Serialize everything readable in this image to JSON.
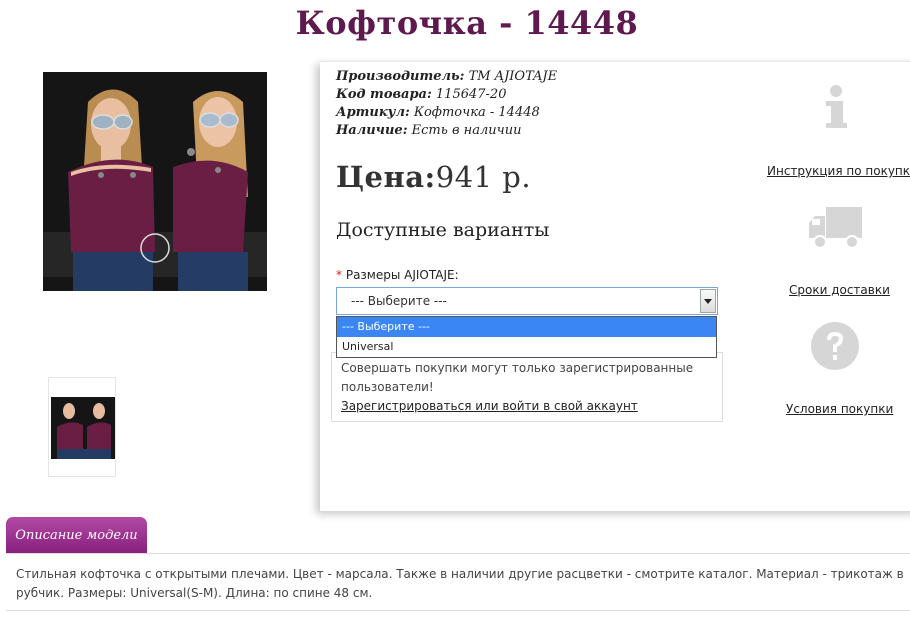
{
  "product": {
    "title": "Кофточка - 14448",
    "image_tag": "14448",
    "brand_logo": "Ajiotaje"
  },
  "info": {
    "manufacturer_label": "Производитель:",
    "manufacturer_value": "ТМ AJIOTAJE",
    "code_label": "Код товара:",
    "code_value": "115647-20",
    "article_label": "Артикул:",
    "article_value": "Кофточка - 14448",
    "availability_label": "Наличие:",
    "availability_value": "Есть в наличии"
  },
  "price": {
    "label": "Цена:",
    "value": "941 р."
  },
  "variants": {
    "heading": "Доступные варианты",
    "required_mark": "*",
    "size_label": "Размеры AJIOTAJE:",
    "select_value": "--- Выберите ---",
    "options": [
      "--- Выберите ---",
      "Universal"
    ]
  },
  "notice": {
    "text": "Совершать покупки могут только зарегистрированные пользователи!",
    "link": "Зарегистрироваться или войти в свой аккаунт"
  },
  "side": {
    "instruction_link": "Инструкция по покупке",
    "delivery_link": "Сроки доставки",
    "terms_link": "Условия покупки"
  },
  "tabs": {
    "description_tab": "Описание модели"
  },
  "description": {
    "text": "Стильная кофточка с открытыми плечами. Цвет - марсала. Также в наличии другие расцветки - смотрите каталог. Материал - трикотаж в рубчик. Размеры: Universal(S-M). Длина: по спине 48 см."
  },
  "colors": {
    "title": "#5e1a4f",
    "tab": "#9b2e8f",
    "select_highlight": "#3a86f5",
    "required": "#e31c1c",
    "icons": "#d6d6d6"
  }
}
